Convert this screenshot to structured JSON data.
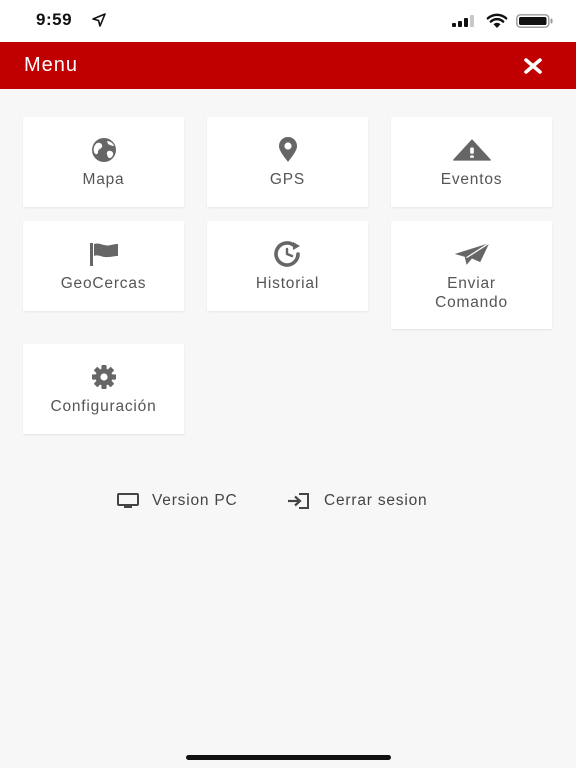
{
  "status_bar": {
    "time": "9:59"
  },
  "header": {
    "title": "Menu"
  },
  "tiles": [
    {
      "label": "Mapa",
      "icon": "globe-icon"
    },
    {
      "label": "GPS",
      "icon": "map-pin-icon"
    },
    {
      "label": "Eventos",
      "icon": "warning-icon"
    },
    {
      "label": "GeoCercas",
      "icon": "flag-icon"
    },
    {
      "label": "Historial",
      "icon": "history-icon"
    },
    {
      "label_line1": "Enviar",
      "label_line2": "Comando",
      "icon": "paper-plane-icon"
    },
    {
      "label": "Configuración",
      "icon": "gear-icon"
    }
  ],
  "links": {
    "version_pc": "Version PC",
    "cerrar_sesion": "Cerrar sesion"
  },
  "colors": {
    "header_bg": "#c00000",
    "icon": "#666666",
    "text": "#555555"
  }
}
